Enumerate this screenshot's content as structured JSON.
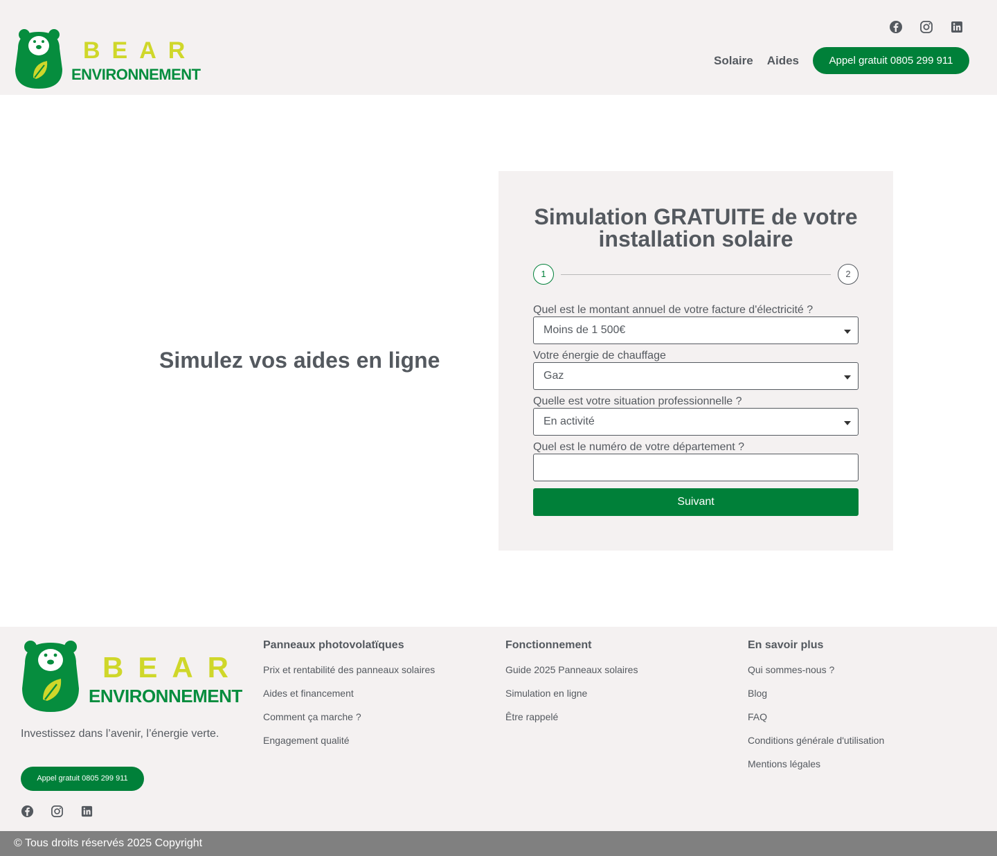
{
  "brand": {
    "name_top": "BEAR",
    "name_bottom": "ENVIRONNEMENT",
    "primary_color": "#008039",
    "accent_color": "#cfd72a",
    "bear_color": "#068d3e"
  },
  "header": {
    "social": [
      "facebook-icon",
      "instagram-icon",
      "linkedin-icon"
    ],
    "nav": [
      {
        "label": "Solaire"
      },
      {
        "label": "Aides"
      }
    ],
    "cta_label": "Appel gratuit 0805 299 911"
  },
  "hero": {
    "title": "Simulez vos aides en ligne"
  },
  "form": {
    "title": "Simulation GRATUITE de votre installation solaire",
    "steps": [
      "1",
      "2"
    ],
    "current_step": 1,
    "fields": [
      {
        "label": "Quel est le montant annuel de votre facture d'électricité ?",
        "value": "Moins de 1 500€",
        "type": "select"
      },
      {
        "label": "Votre énergie de chauffage",
        "value": "Gaz",
        "type": "select"
      },
      {
        "label": "Quelle est votre situation professionnelle ?",
        "value": "En activité",
        "type": "select"
      },
      {
        "label": "Quel est le numéro de votre département ?",
        "value": "",
        "type": "text"
      }
    ],
    "submit_label": "Suivant"
  },
  "footer": {
    "tagline": "Investissez dans l’avenir, l’énergie verte.",
    "cta_label": "Appel gratuit 0805 299 911",
    "social": [
      "facebook-icon",
      "instagram-icon",
      "linkedin-icon"
    ],
    "columns": [
      {
        "title": "Panneaux photovolatïques",
        "links": [
          "Prix et rentabilité des panneaux solaires",
          "Aides et financement",
          "Comment ça marche ?",
          "Engagement qualité"
        ]
      },
      {
        "title": "Fonctionnement",
        "links": [
          "Guide 2025 Panneaux solaires",
          "Simulation en ligne",
          "Être rappelé"
        ]
      },
      {
        "title": "En savoir plus",
        "links": [
          "Qui sommes-nous ?",
          "Blog",
          "FAQ",
          "Conditions générale d'utilisation",
          "Mentions légales"
        ]
      }
    ],
    "copyright": "© Tous droits réservés 2025 Copyright"
  }
}
